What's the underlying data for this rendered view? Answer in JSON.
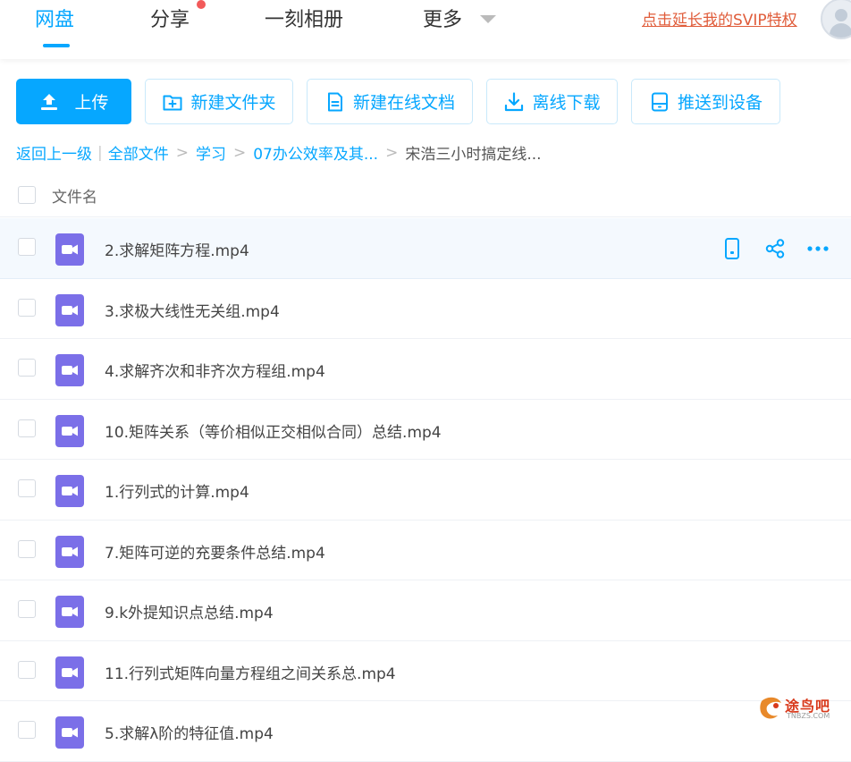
{
  "nav": {
    "items": [
      {
        "label": "网盘",
        "active": true
      },
      {
        "label": "分享",
        "has_dot": true
      },
      {
        "label": "一刻相册"
      },
      {
        "label": "更多"
      }
    ],
    "svip_link": "点击延长我的SVIP特权"
  },
  "toolbar": {
    "upload": "上传",
    "new_folder": "新建文件夹",
    "new_doc": "新建在线文档",
    "offline_download": "离线下载",
    "push_device": "推送到设备"
  },
  "breadcrumb": {
    "back": "返回上一级",
    "items": [
      "全部文件",
      "学习",
      "07办公效率及其..."
    ],
    "current": "宋浩三小时搞定线..."
  },
  "list": {
    "header": "文件名",
    "files": [
      {
        "name": "2.求解矩阵方程.mp4"
      },
      {
        "name": "3.求极大线性无关组.mp4"
      },
      {
        "name": "4.求解齐次和非齐次方程组.mp4"
      },
      {
        "name": "10.矩阵关系（等价相似正交相似合同）总结.mp4"
      },
      {
        "name": "1.行列式的计算.mp4"
      },
      {
        "name": "7.矩阵可逆的充要条件总结.mp4"
      },
      {
        "name": "9.k外提知识点总结.mp4"
      },
      {
        "name": "11.行列式矩阵向量方程组之间关系总.mp4"
      },
      {
        "name": "5.求解λ阶的特征值.mp4"
      }
    ]
  },
  "watermark": {
    "text": "途鸟吧",
    "sub": "TNBZS.COM"
  },
  "colors": {
    "accent": "#06a7ff",
    "video_icon": "#7b6fe8",
    "svip": "#e05c3a",
    "dot": "#f25a5a"
  }
}
